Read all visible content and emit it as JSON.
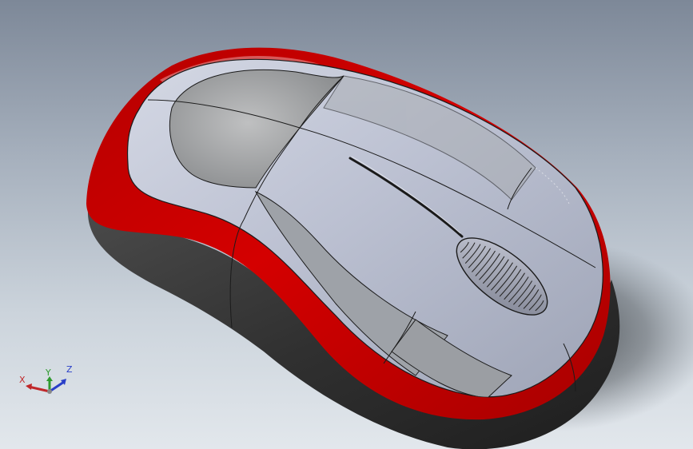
{
  "triad": {
    "x_label": "X",
    "y_label": "Y",
    "z_label": "Z",
    "x_color": "#c0282a",
    "y_color": "#2f9a2f",
    "z_color": "#2a3fc8"
  },
  "model": {
    "shell_color": "#c60000",
    "top_color": "#b7bdcc",
    "button_color": "#a3a5a8",
    "base_color": "#3c3c3c"
  }
}
